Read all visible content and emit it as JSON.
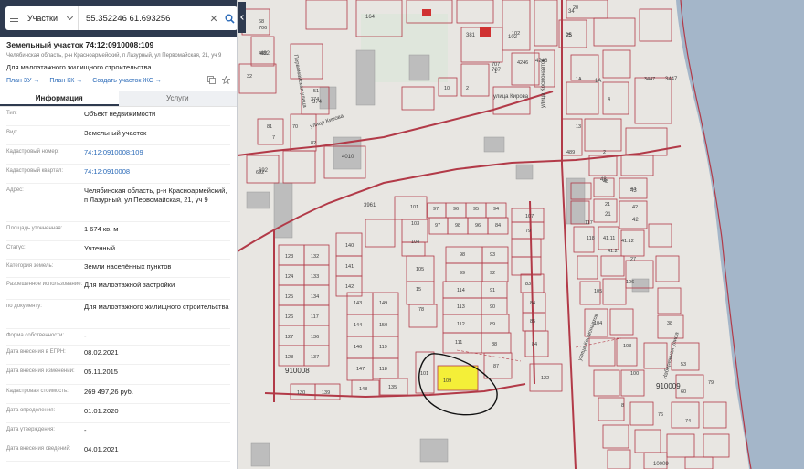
{
  "search": {
    "type_label": "Участки",
    "query": "55.352246 61.693256"
  },
  "parcel": {
    "title": "Земельный участок 74:12:0910008:109",
    "address_short": "Челябинская область, р-н Красноармейский, п Лазурный, ул Первомайская, 21, уч 9",
    "permitted_use": "Для малоэтажного жилищного строительства"
  },
  "links": {
    "plan_zu": "План ЗУ →",
    "plan_kk": "План КК →",
    "create_zhs": "Создать участок ЖС →"
  },
  "tabs": {
    "info": "Информация",
    "services": "Услуги"
  },
  "info_rows": [
    {
      "key": "Тип:",
      "value": "Объект недвижимости"
    },
    {
      "key": "Вид:",
      "value": "Земельный участок"
    },
    {
      "key": "Кадастровый номер:",
      "value": "74:12:0910008:109"
    },
    {
      "key": "Кадастровый квартал:",
      "value": "74:12:0910008"
    },
    {
      "key": "Адрес:",
      "value": "Челябинская область, р-н Красноармейский, п Лазурный, ул Первомайская, 21, уч 9"
    },
    {
      "key": "Площадь уточненная:",
      "value": "1 674 кв. м"
    },
    {
      "key": "Статус:",
      "value": "Учтенный"
    },
    {
      "key": "Категория земель:",
      "value": "Земли населённых пунктов"
    },
    {
      "key": "Разрешенное использование:",
      "value": "Для малоэтажной застройки"
    },
    {
      "key": "по документу:",
      "value": "Для малоэтажного жилищного строительства"
    },
    {
      "key": "Форма собственности:",
      "value": "-"
    },
    {
      "key": "Дата внесения в ЕГРН:",
      "value": "08.02.2021"
    },
    {
      "key": "Дата внесения изменений:",
      "value": "05.11.2015"
    },
    {
      "key": "Кадастровая стоимость:",
      "value": "269 497,26 руб."
    },
    {
      "key": "Дата определения:",
      "value": "01.01.2020"
    },
    {
      "key": "Дата утверждения:",
      "value": "-"
    },
    {
      "key": "Дата внесения сведений:",
      "value": "04.01.2021"
    }
  ],
  "map": {
    "streets": {
      "kirova_top": "улица Кирова",
      "kirova_left": "улица Кирова",
      "kosmonavtov": "улица Космонавтов",
      "pervomayskaya": "Первомайская улица",
      "kosmonavtov_lower": "улица Космонавтов",
      "naberezhnaya": "Набережная улица"
    },
    "quarters": {
      "q1": "910008",
      "q2": "910009"
    },
    "building_numbers": [
      "164",
      "381",
      "102",
      "4246",
      "707",
      "25",
      "34",
      "1А",
      "3447",
      "482",
      "374",
      "4010",
      "692",
      "3961",
      "48",
      "21",
      "43",
      "42",
      "10009"
    ],
    "selected_parcel": "109",
    "colors": {
      "boundary": "#b23a48",
      "selected_fill": "#f4ef38",
      "water": "#9fb3c8",
      "panel_header": "#2e3a4f",
      "link": "#2a6ab8"
    }
  }
}
